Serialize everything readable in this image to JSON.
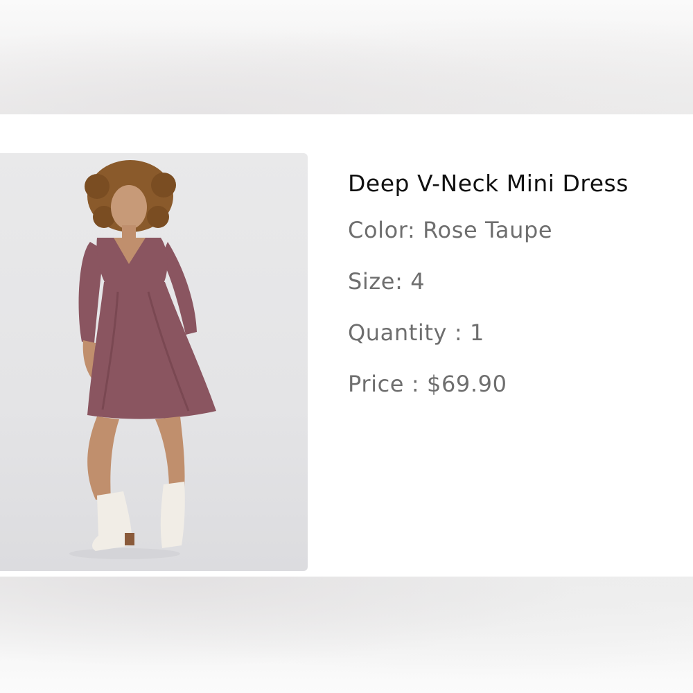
{
  "product": {
    "title": "Deep V-Neck Mini Dress",
    "color_label": "Color: Rose Taupe",
    "size_label": "Size: 4",
    "quantity_label": "Quantity : 1",
    "price_label": "Price : $69.90"
  },
  "colors": {
    "dress": "#8a5560",
    "background": "#e7e7e9",
    "boots": "#f1ede6"
  }
}
